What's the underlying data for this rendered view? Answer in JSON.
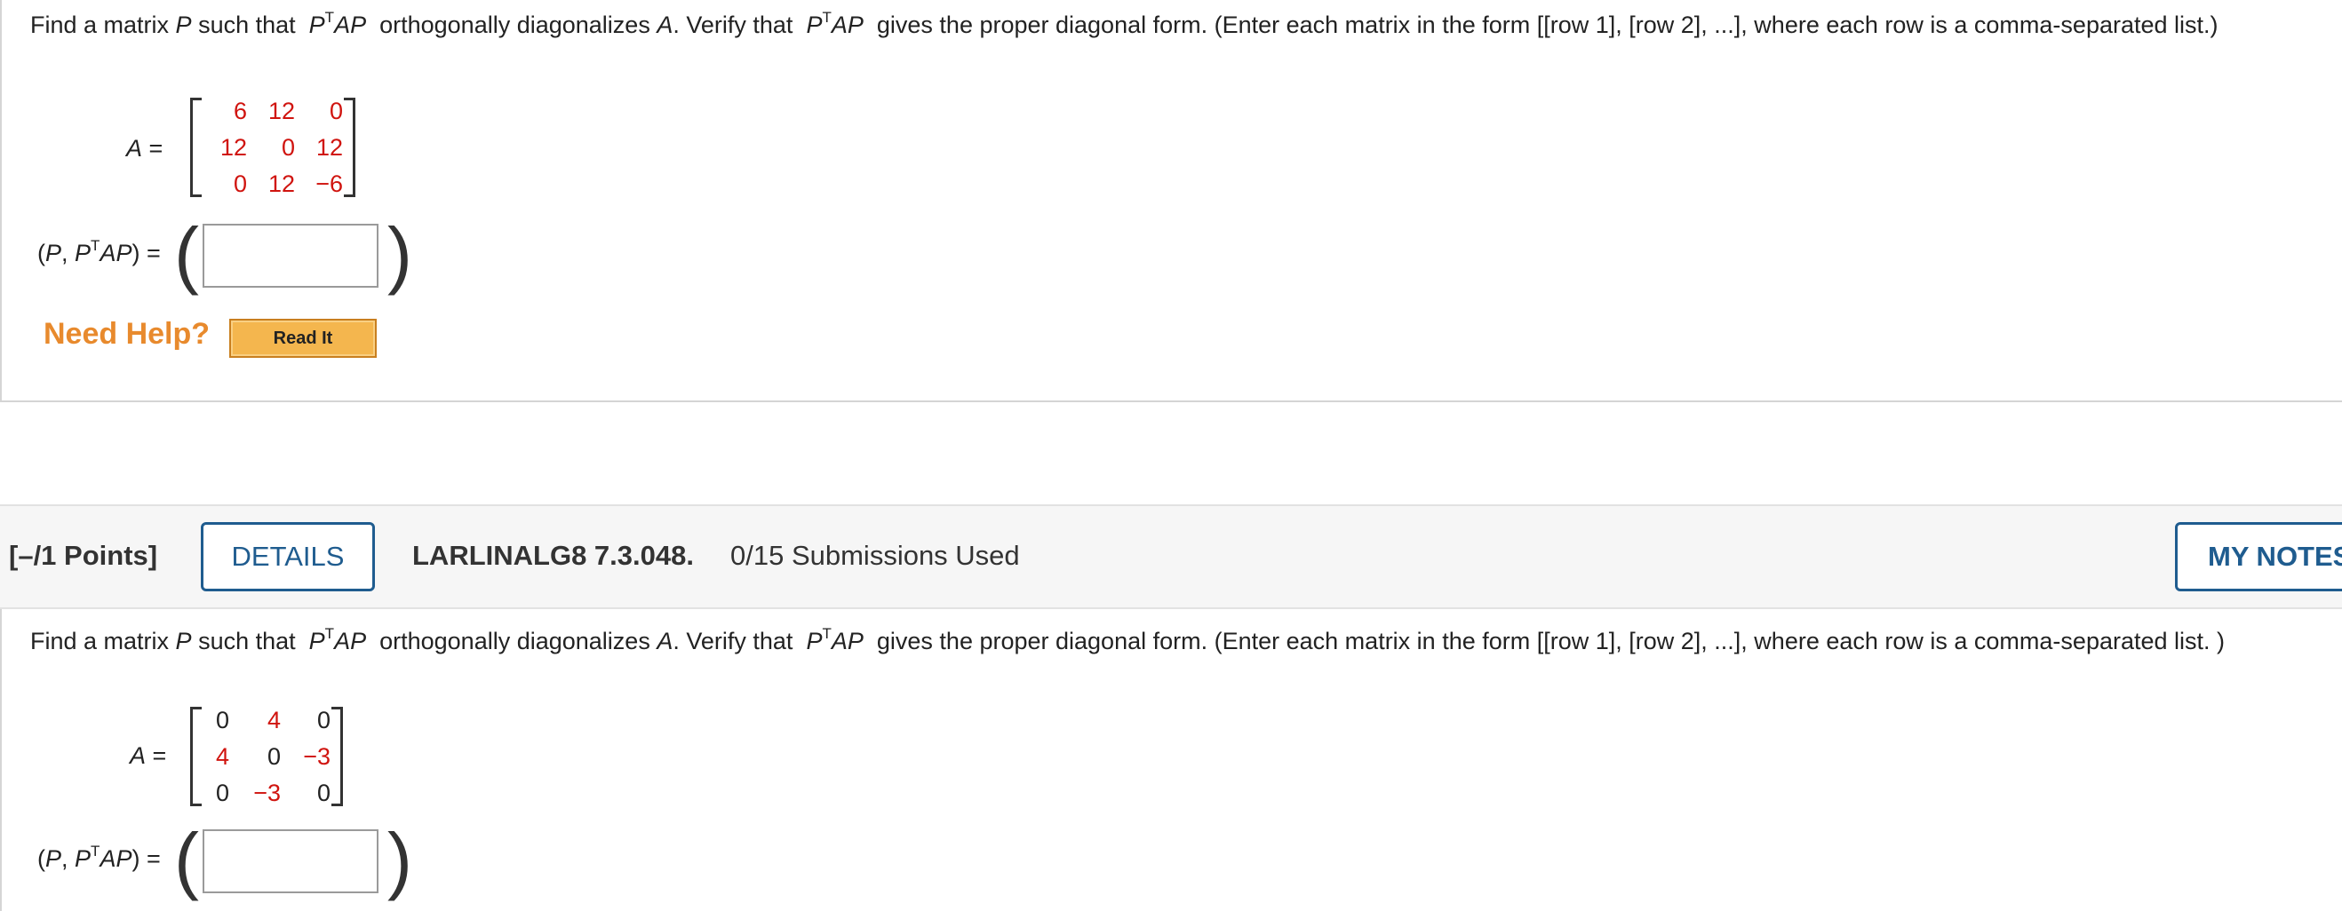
{
  "question1": {
    "prompt_part1": "Find a matrix ",
    "P": "P",
    "prompt_part2": " such that ",
    "ptap_P": "P",
    "ptap_T": "T",
    "ptap_AP": "AP",
    "prompt_part3": " orthogonally diagonalizes ",
    "A": "A",
    "prompt_part4": ". Verify that ",
    "prompt_part5": " gives the proper diagonal form. (Enter each matrix in the form [[row 1], [row 2], ...], where each row is a comma-separated list.)",
    "matrix_label": "A =",
    "matrix": [
      [
        "6",
        "12",
        "0"
      ],
      [
        "12",
        "0",
        "12"
      ],
      [
        "0",
        "12",
        "−6"
      ]
    ],
    "answer_label_open": "(P, P",
    "answer_label_T": "T",
    "answer_label_close": "AP) =",
    "answer_value": "",
    "need_help": "Need Help?",
    "read_it": "Read It"
  },
  "question2": {
    "points": "[–/1 Points]",
    "details": "DETAILS",
    "problem_id": "LARLINALG8 7.3.048.",
    "submissions": "0/15 Submissions Used",
    "my_notes": "MY NOTES",
    "prompt_part1": "Find a matrix ",
    "P": "P",
    "prompt_part2": " such that ",
    "ptap_P": "P",
    "ptap_T": "T",
    "ptap_AP": "AP",
    "prompt_part3": " orthogonally diagonalizes ",
    "A": "A",
    "prompt_part4": ". Verify that ",
    "prompt_part5": " gives the proper diagonal form. (Enter each matrix in the form [[row 1], [row 2], ...], where each row is a comma-separated list. )",
    "matrix_label": "A =",
    "matrix": [
      [
        "0",
        "4",
        "0"
      ],
      [
        "4",
        "0",
        "−3"
      ],
      [
        "0",
        "−3",
        "0"
      ]
    ],
    "answer_label_open": "(P, P",
    "answer_label_T": "T",
    "answer_label_close": "AP) =",
    "answer_value": ""
  },
  "colors": {
    "matrix_entry_red": "#d0140f",
    "need_help_orange": "#e88a2d",
    "button_blue": "#1f5c8f",
    "read_it_bg": "#f4b64e"
  }
}
